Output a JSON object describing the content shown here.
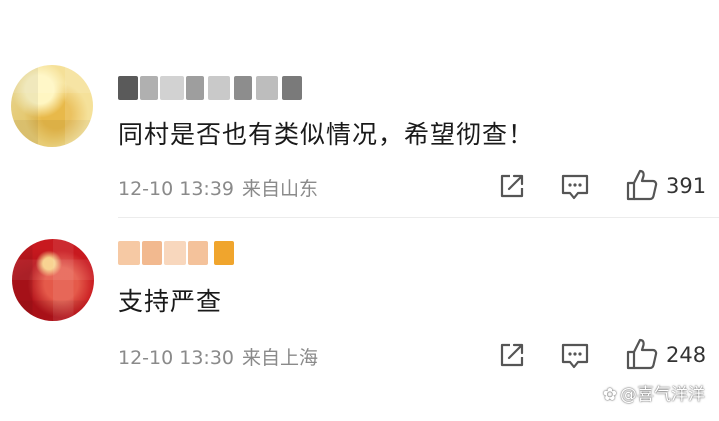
{
  "comments": [
    {
      "text": "同村是否也有类似情况，希望彻查！",
      "time": "12-10 13:39",
      "location": "来自山东",
      "likes": "391"
    },
    {
      "text": "支持严查",
      "time": "12-10 13:30",
      "location": "来自上海",
      "likes": "248"
    }
  ],
  "icons": {
    "share": "share-icon",
    "reply": "comment-icon",
    "like": "thumbs-up-icon"
  },
  "colors": {
    "meta_text": "#8a8a8a",
    "comment_text": "#1a1a1a",
    "icon_stroke": "#555555"
  },
  "watermark": {
    "text": "@喜气洋洋"
  }
}
